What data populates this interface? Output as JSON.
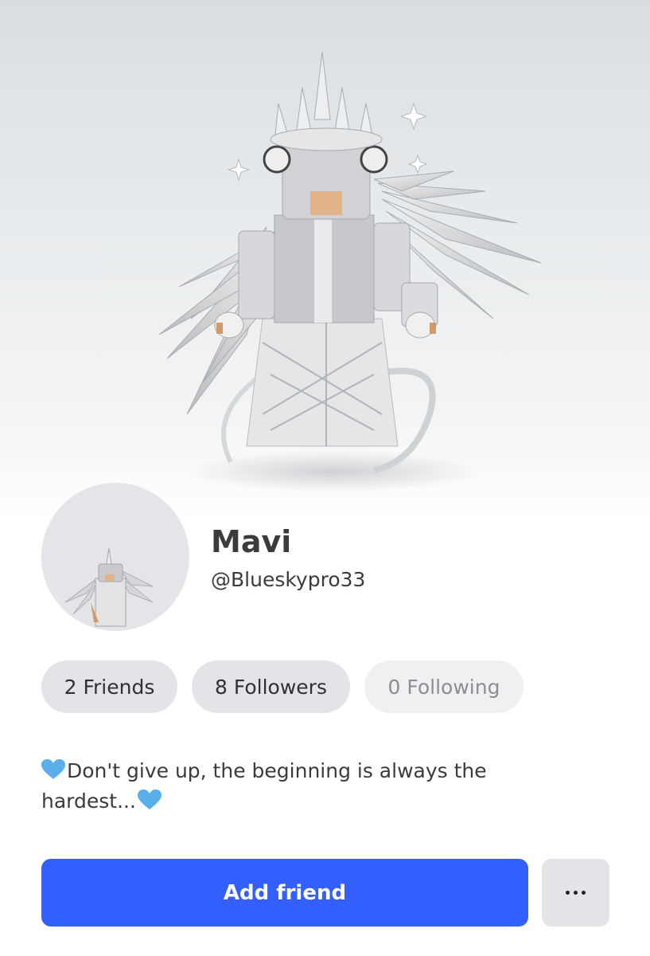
{
  "profile": {
    "display_name": "Mavi",
    "username": "@Blueskypro33",
    "hero_image": "roblox-avatar-silver-angel",
    "thumbnail_image": "roblox-avatar-headshot"
  },
  "stats": {
    "friends": "2 Friends",
    "followers": "8 Followers",
    "following": "0 Following"
  },
  "bio": {
    "text": "Don't give up, the beginning is always the hardest...",
    "emoji": "blue-heart-icon"
  },
  "actions": {
    "add_friend": "Add friend",
    "more_icon": "more-horizontal-icon"
  },
  "colors": {
    "primary_button": "#335fff",
    "pill_background": "#e3e4e8",
    "heart": "#5aaeea"
  }
}
